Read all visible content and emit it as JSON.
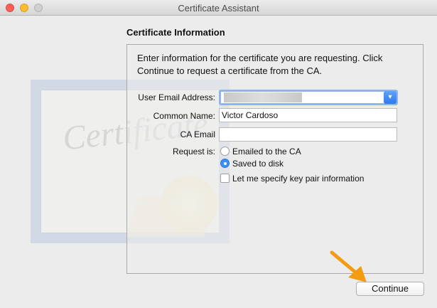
{
  "window": {
    "title": "Certificate Assistant"
  },
  "watermark": {
    "word": "Certificate"
  },
  "section": {
    "heading": "Certificate Information",
    "instructions": "Enter information for the certificate you are requesting. Click Continue to request a certificate from the CA."
  },
  "form": {
    "email_label": "User Email Address:",
    "email_value": "",
    "common_name_label": "Common Name:",
    "common_name_value": "Victor Cardoso",
    "ca_email_label": "CA Email",
    "ca_email_value": "",
    "request_label": "Request is:",
    "options": [
      {
        "label": "Emailed to the CA",
        "selected": false
      },
      {
        "label": "Saved to disk",
        "selected": true
      }
    ],
    "key_pair_label": "Let me specify key pair information",
    "key_pair_checked": false
  },
  "footer": {
    "continue_label": "Continue"
  },
  "colors": {
    "accent": "#3b8ef5",
    "arrow": "#f39c12"
  },
  "icons": {
    "combo": "chevron-down-icon",
    "arrow": "arrow-down-right-icon"
  }
}
